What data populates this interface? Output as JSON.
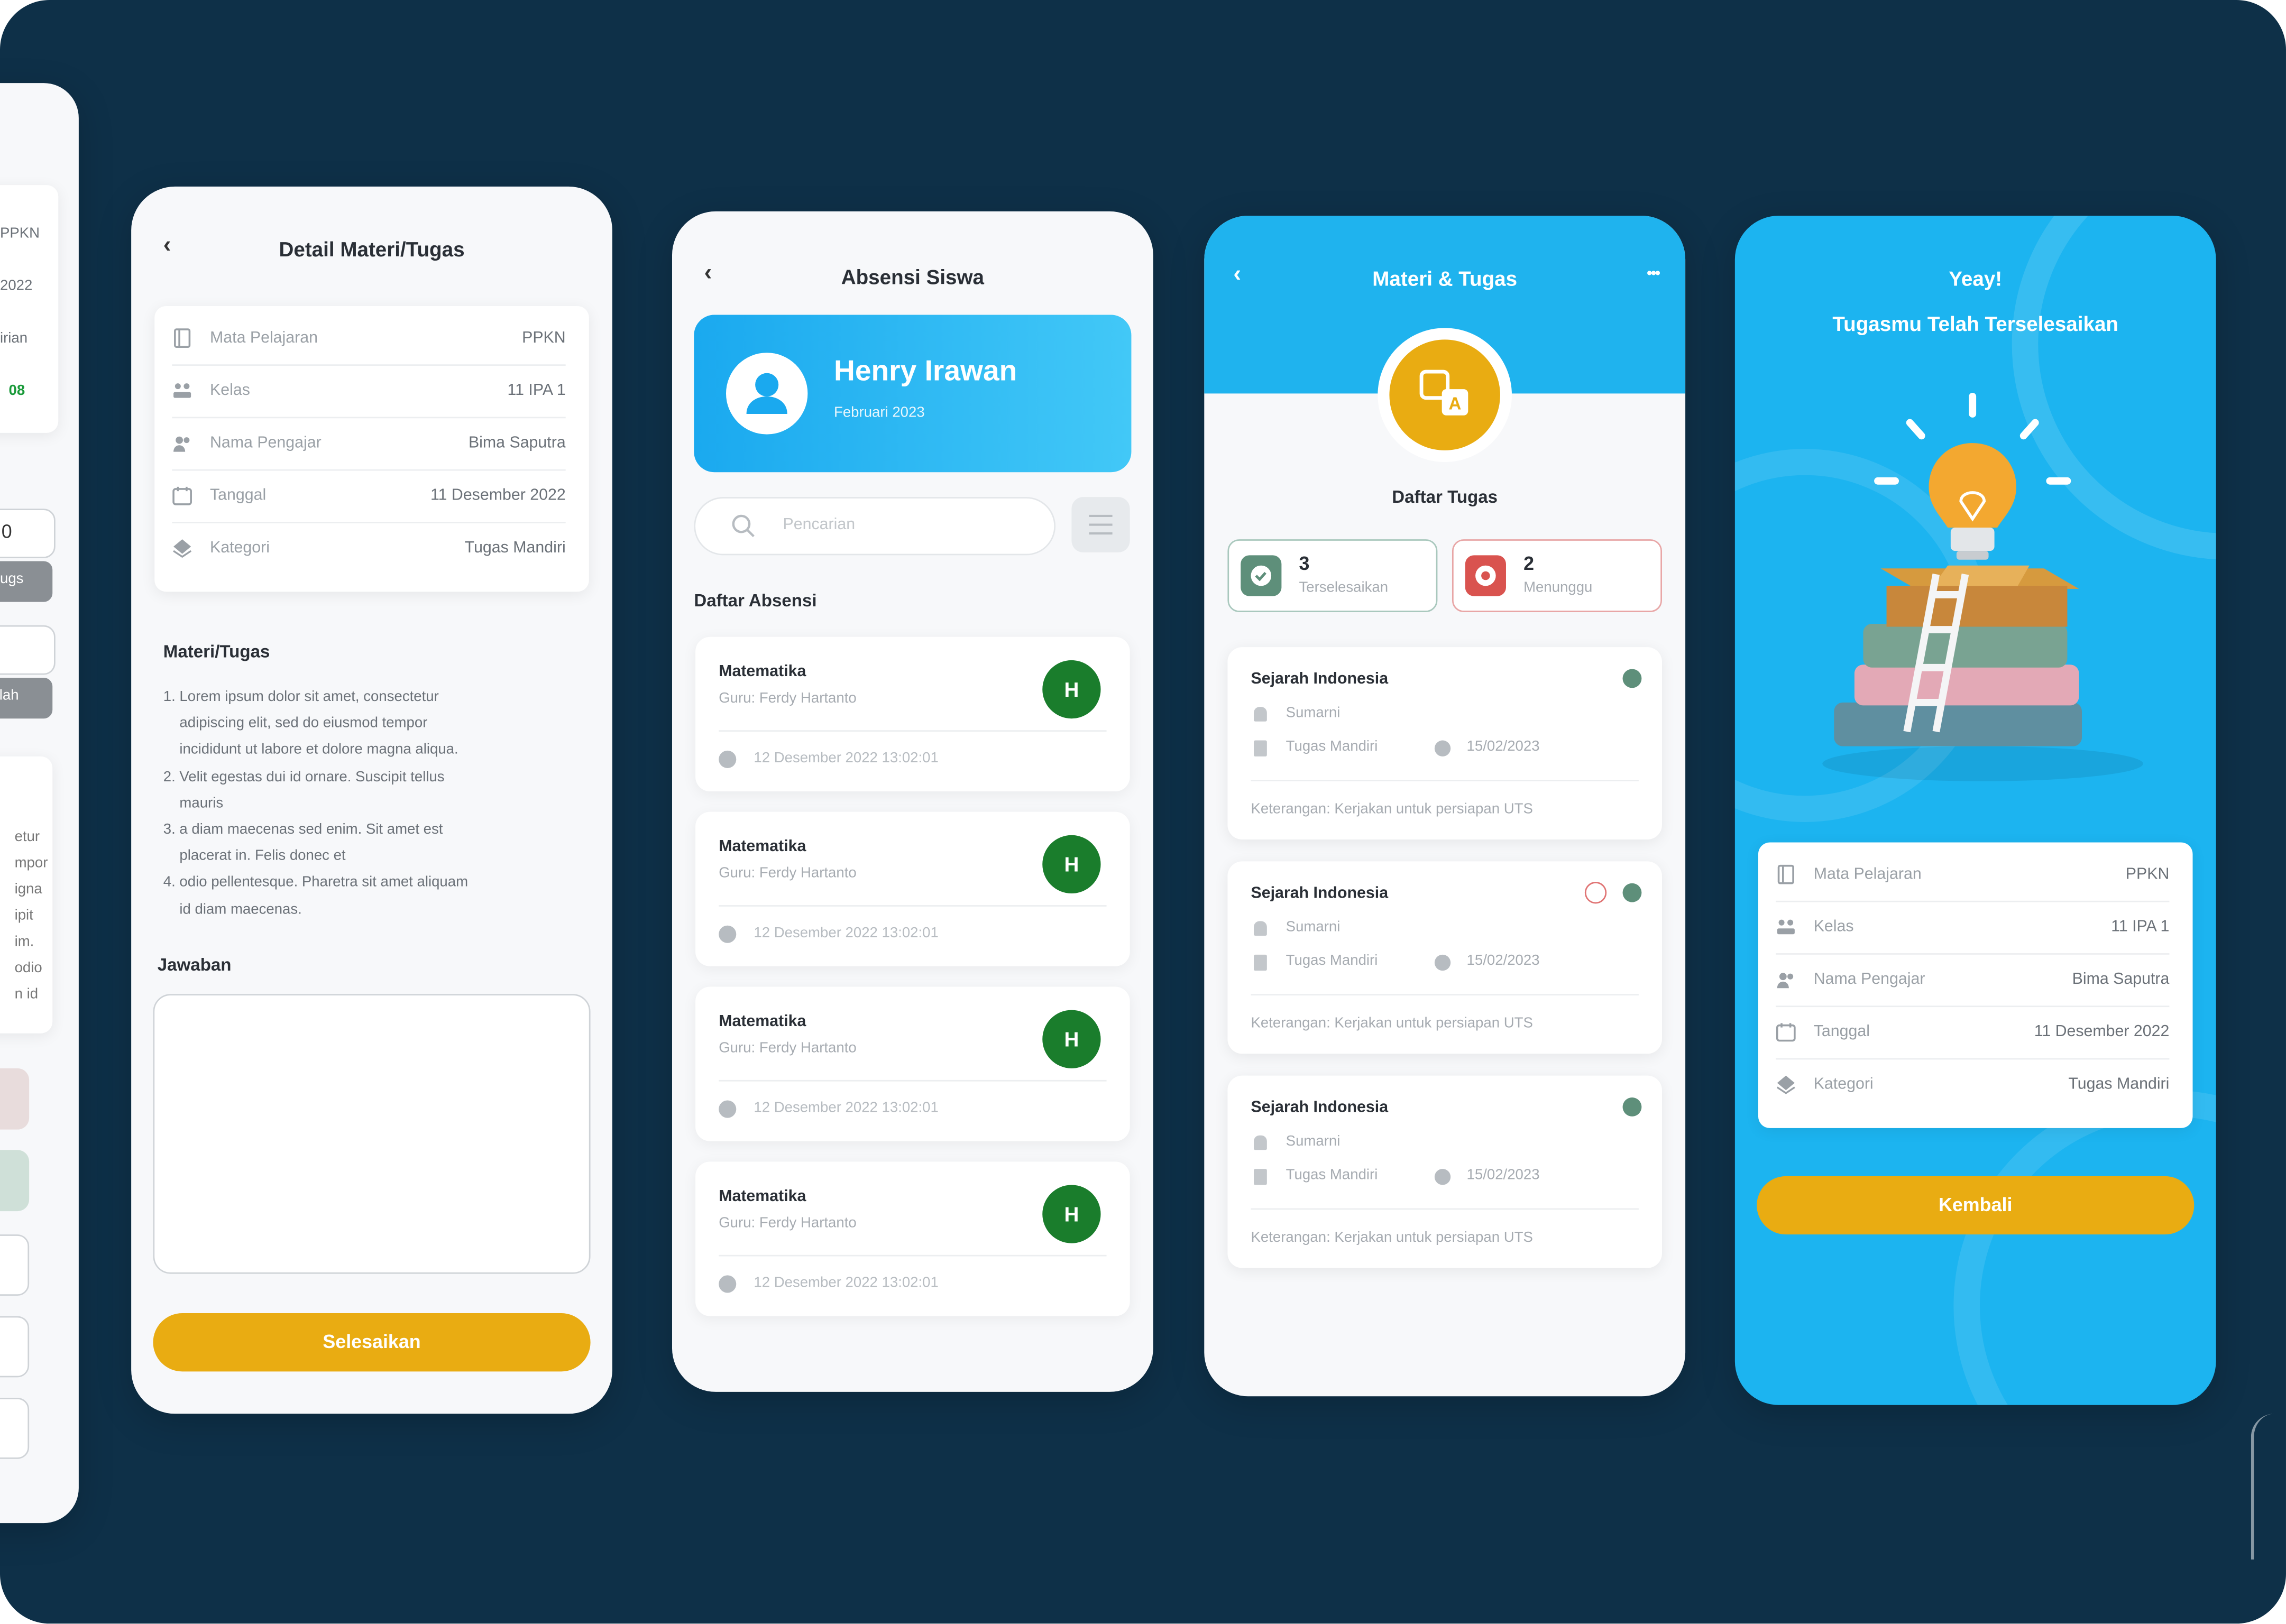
{
  "colors": {
    "background": "#0e3048",
    "accent_blue": "#1fb3ee",
    "accent_yellow": "#e9ac12",
    "avatar_green": "#1a7d2c",
    "done_green": "#5e8f7a",
    "pending_red": "#d9534f"
  },
  "screen0": {
    "values": [
      "PPKN",
      "2022",
      "irian",
      "08"
    ],
    "input_value": "0",
    "btn_label": "ugs",
    "btn2_label": "alah",
    "text_lines": [
      "etur",
      "mpor",
      "igna",
      "ipit",
      "im.",
      "odio",
      "n id"
    ]
  },
  "screen1": {
    "title": "Detail Materi/Tugas",
    "info": [
      {
        "icon": "book-icon",
        "label": "Mata Pelajaran",
        "value": "PPKN"
      },
      {
        "icon": "class-icon",
        "label": "Kelas",
        "value": "11 IPA 1"
      },
      {
        "icon": "teacher-icon",
        "label": "Nama Pengajar",
        "value": "Bima Saputra"
      },
      {
        "icon": "calendar-icon",
        "label": "Tanggal",
        "value": "11 Desember 2022"
      },
      {
        "icon": "category-icon",
        "label": "Kategori",
        "value": "Tugas Mandiri"
      }
    ],
    "material_heading": "Materi/Tugas",
    "material_lines": [
      "1. Lorem ipsum dolor sit amet, consectetur",
      "    adipiscing elit, sed do eiusmod tempor",
      "    incididunt ut labore et dolore magna aliqua.",
      "2. Velit egestas dui id ornare. Suscipit tellus",
      "    mauris",
      "3. a diam maecenas sed enim. Sit amet est",
      "    placerat in. Felis donec et",
      "4. odio pellentesque. Pharetra sit amet aliquam",
      "    id diam maecenas."
    ],
    "answer_label": "Jawaban",
    "answer_value": "",
    "submit_label": "Selesaikan"
  },
  "screen2": {
    "title": "Absensi Siswa",
    "profile_name": "Henry Irawan",
    "profile_date": "Februari 2023",
    "search_placeholder": "Pencarian",
    "list_heading": "Daftar Absensi",
    "items": [
      {
        "subject": "Matematika",
        "teacher": "Guru: Ferdy Hartanto",
        "status": "H",
        "time": "12 Desember 2022 13:02:01"
      },
      {
        "subject": "Matematika",
        "teacher": "Guru: Ferdy Hartanto",
        "status": "H",
        "time": "12 Desember 2022 13:02:01"
      },
      {
        "subject": "Matematika",
        "teacher": "Guru: Ferdy Hartanto",
        "status": "H",
        "time": "12 Desember 2022 13:02:01"
      },
      {
        "subject": "Matematika",
        "teacher": "Guru: Ferdy Hartanto",
        "status": "H",
        "time": "12 Desember 2022 13:02:01"
      }
    ]
  },
  "screen3": {
    "title": "Materi & Tugas",
    "more": "•••",
    "heading": "Daftar Tugas",
    "done_count": "3",
    "done_label": "Terselesaikan",
    "pending_count": "2",
    "pending_label": "Menunggu",
    "tasks": [
      {
        "title": "Sejarah Indonesia",
        "teacher": "Sumarni",
        "category": "Tugas Mandiri",
        "date": "15/02/2023",
        "note": "Keterangan: Kerjakan untuk persiapan UTS"
      },
      {
        "title": "Sejarah Indonesia",
        "teacher": "Sumarni",
        "category": "Tugas Mandiri",
        "date": "15/02/2023",
        "note": "Keterangan: Kerjakan untuk persiapan UTS"
      },
      {
        "title": "Sejarah Indonesia",
        "teacher": "Sumarni",
        "category": "Tugas Mandiri",
        "date": "15/02/2023",
        "note": "Keterangan: Kerjakan untuk persiapan UTS"
      }
    ]
  },
  "screen4": {
    "title_line1": "Yeay!",
    "title_line2": "Tugasmu Telah Terselesaikan",
    "info": [
      {
        "icon": "book-icon",
        "label": "Mata Pelajaran",
        "value": "PPKN"
      },
      {
        "icon": "class-icon",
        "label": "Kelas",
        "value": "11 IPA 1"
      },
      {
        "icon": "teacher-icon",
        "label": "Nama Pengajar",
        "value": "Bima Saputra"
      },
      {
        "icon": "calendar-icon",
        "label": "Tanggal",
        "value": "11 Desember 2022"
      },
      {
        "icon": "category-icon",
        "label": "Kategori",
        "value": "Tugas Mandiri"
      }
    ],
    "back_label": "Kembali"
  }
}
